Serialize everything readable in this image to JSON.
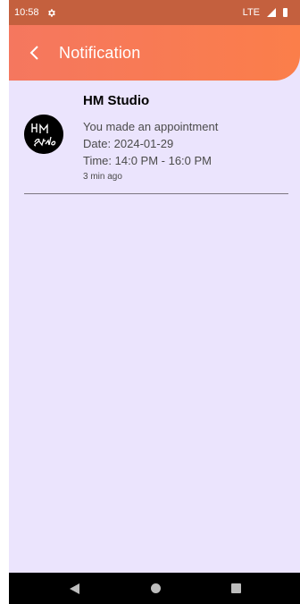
{
  "status_bar": {
    "time": "10:58",
    "network": "LTE",
    "settings_icon": "gear-icon",
    "signal_icon": "signal-icon",
    "battery_icon": "battery-icon"
  },
  "app_bar": {
    "title": "Notification",
    "back_icon": "chevron-left-icon",
    "color_start": "#f5775f",
    "color_end": "#fb7e4a"
  },
  "notifications": [
    {
      "title": "HM Studio",
      "avatar_icon": "hm-studio-logo",
      "message": "You made an appointment",
      "date": "Date: 2024-01-29",
      "time": "Time: 14:0 PM - 16:0 PM",
      "ago": "3 min ago"
    }
  ],
  "nav_bar": {
    "back_icon": "back-triangle-icon",
    "home_icon": "home-circle-icon",
    "recents_icon": "recents-square-icon"
  },
  "colors": {
    "background": "#ebe4fd",
    "status_bar": "#c4603e"
  }
}
